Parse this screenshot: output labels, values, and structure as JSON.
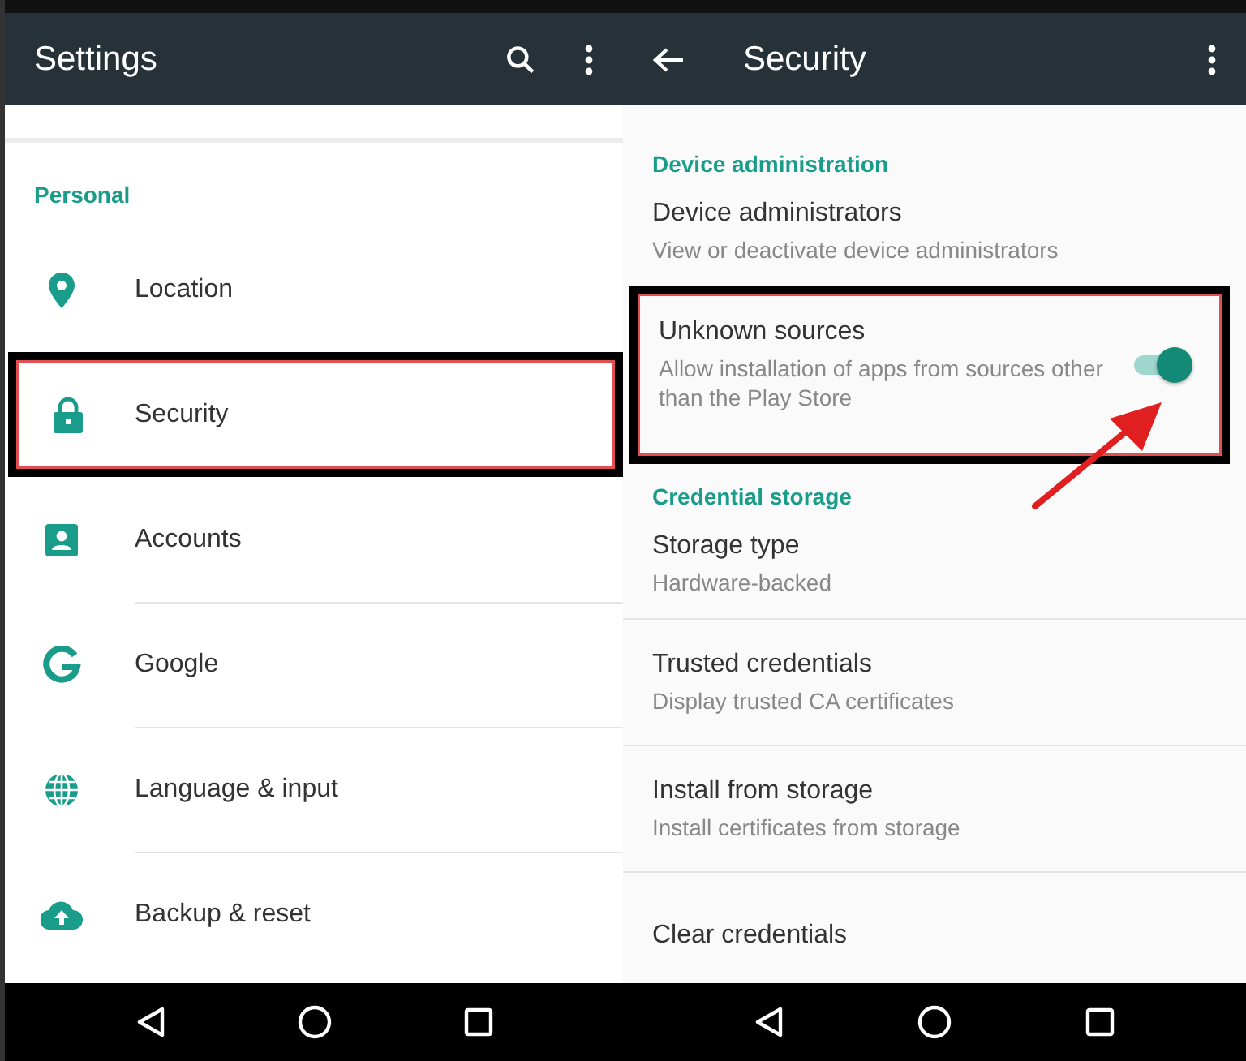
{
  "left": {
    "title": "Settings",
    "section": "Personal",
    "items": [
      {
        "label": "Location",
        "highlighted": false
      },
      {
        "label": "Security",
        "highlighted": true
      },
      {
        "label": "Accounts",
        "highlighted": false
      },
      {
        "label": "Google",
        "highlighted": false
      },
      {
        "label": "Language & input",
        "highlighted": false
      },
      {
        "label": "Backup & reset",
        "highlighted": false
      }
    ]
  },
  "right": {
    "title": "Security",
    "sections": [
      {
        "header": "Device administration",
        "items": [
          {
            "kind": "plain",
            "title": "Device administrators",
            "subtitle": "View or deactivate device administrators",
            "highlighted": false
          },
          {
            "kind": "switch",
            "title": "Unknown sources",
            "subtitle": "Allow installation of apps from sources other than the Play Store",
            "on": true,
            "highlighted": true
          }
        ]
      },
      {
        "header": "Credential storage",
        "items": [
          {
            "kind": "plain",
            "title": "Storage type",
            "subtitle": "Hardware-backed",
            "highlighted": false
          },
          {
            "kind": "plain",
            "title": "Trusted credentials",
            "subtitle": "Display trusted CA certificates",
            "highlighted": false
          },
          {
            "kind": "plain",
            "title": "Install from storage",
            "subtitle": "Install certificates from storage",
            "highlighted": false
          },
          {
            "kind": "plain",
            "title": "Clear credentials",
            "highlighted": false
          }
        ]
      }
    ]
  }
}
